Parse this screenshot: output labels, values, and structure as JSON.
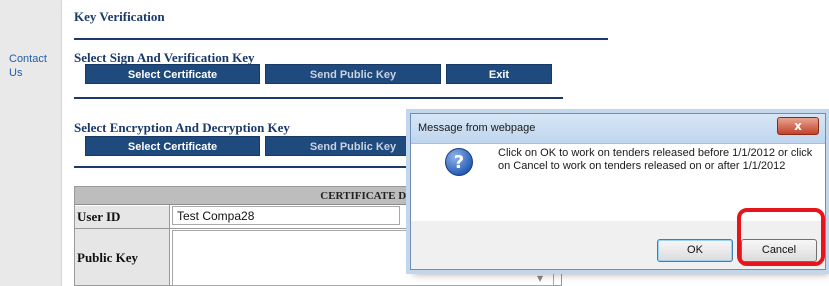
{
  "sidebar": {
    "contact_label": "Contact Us"
  },
  "key_verification": {
    "title": "Key Verification",
    "sign_section_title": "Select Sign And Verification Key",
    "sign_buttons": [
      "Select Certificate",
      "Send Public Key",
      "Exit"
    ],
    "encryption_section_title": "Select Encryption And Decryption Key",
    "encryption_buttons": [
      "Select Certificate",
      "Send Public Key"
    ]
  },
  "certificate_details": {
    "header": "CERTIFICATE DETAILS",
    "user_id_label": "User ID",
    "user_id_value": "Test Compa28",
    "public_key_label": "Public Key",
    "public_key_value": ""
  },
  "dialog": {
    "title": "Message from webpage",
    "close_glyph": "x",
    "icon_glyph": "?",
    "message": "Click on OK to work on tenders released before 1/1/2012 or click on Cancel to work on tenders released on or after 1/1/2012",
    "ok_label": "OK",
    "cancel_label": "Cancel"
  },
  "colors": {
    "brand_navy": "#1f4a7d",
    "heading_navy": "#1b3a6b",
    "link_blue": "#1f5fa8",
    "highlight_red": "#e8141b"
  },
  "icons": {
    "dialog_icon": "question-icon",
    "close": "close-icon",
    "scroll": "scroll-down-arrow-icon"
  }
}
